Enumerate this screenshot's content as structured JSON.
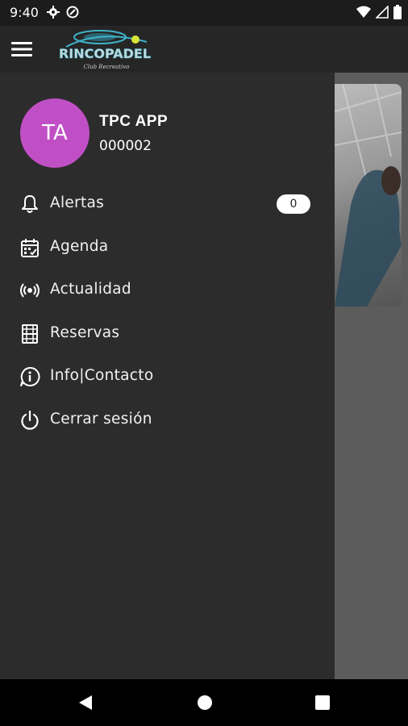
{
  "status_bar": {
    "time": "9:40"
  },
  "app_bar": {
    "logo_text": "RINCOPADEL",
    "logo_subtext": "Club Recreativo"
  },
  "user": {
    "initials": "TA",
    "name": "TPC APP",
    "id": "000002",
    "avatar_color": "#c04fc6"
  },
  "menu": {
    "items": [
      {
        "label": "Alertas",
        "icon": "bell-icon",
        "badge": "0"
      },
      {
        "label": "Agenda",
        "icon": "calendar-icon"
      },
      {
        "label": "Actualidad",
        "icon": "broadcast-icon"
      },
      {
        "label": "Reservas",
        "icon": "court-icon"
      },
      {
        "label": "Info|Contacto",
        "icon": "info-chat-icon"
      },
      {
        "label": "Cerrar sesión",
        "icon": "power-icon"
      }
    ]
  },
  "colors": {
    "drawer_bg": "#2c2c2c",
    "app_bar_bg": "#262626",
    "scrim": "#5c5c5c",
    "accent_logo": "#3fb3c9",
    "ball": "#d8e63b"
  }
}
